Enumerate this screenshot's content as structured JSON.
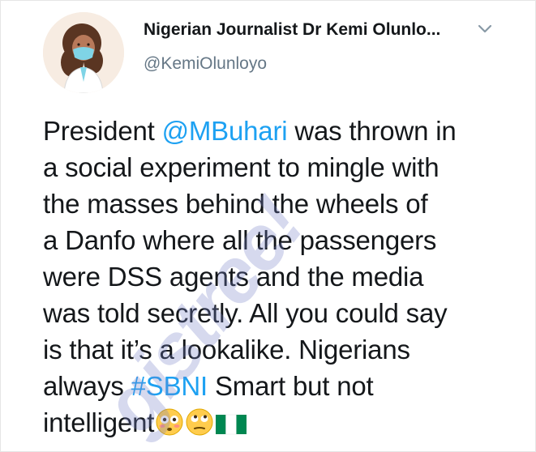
{
  "tweet": {
    "display_name": "Nigerian Journalist Dr Kemi Olunlo...",
    "handle": "@KemiOlunloyo",
    "lines": {
      "l1a": "President ",
      "l1_mention": "@MBuhari",
      "l1b": " was thrown in",
      "l2": "a social experiment to mingle with",
      "l3": "the masses behind the wheels of",
      "l4": "a Danfo where all the passengers",
      "l5": "were DSS agents and the media",
      "l6": "was told secretly. All you could say",
      "l7": "is that it’s a lookalike. Nigerians",
      "l8a": "always ",
      "l8_hashtag": "#SBNI",
      "l8b": " Smart but not",
      "l9": "intelligent"
    },
    "emojis": [
      "flushed-face-emoji",
      "face-with-rolling-eyes-emoji",
      "nigeria-flag-emoji"
    ]
  },
  "watermark": {
    "text": "gistree!"
  },
  "colors": {
    "link": "#1da1f2",
    "secondary": "#657786",
    "text": "#14171a"
  },
  "icons": {
    "menu": "chevron-down-icon"
  }
}
